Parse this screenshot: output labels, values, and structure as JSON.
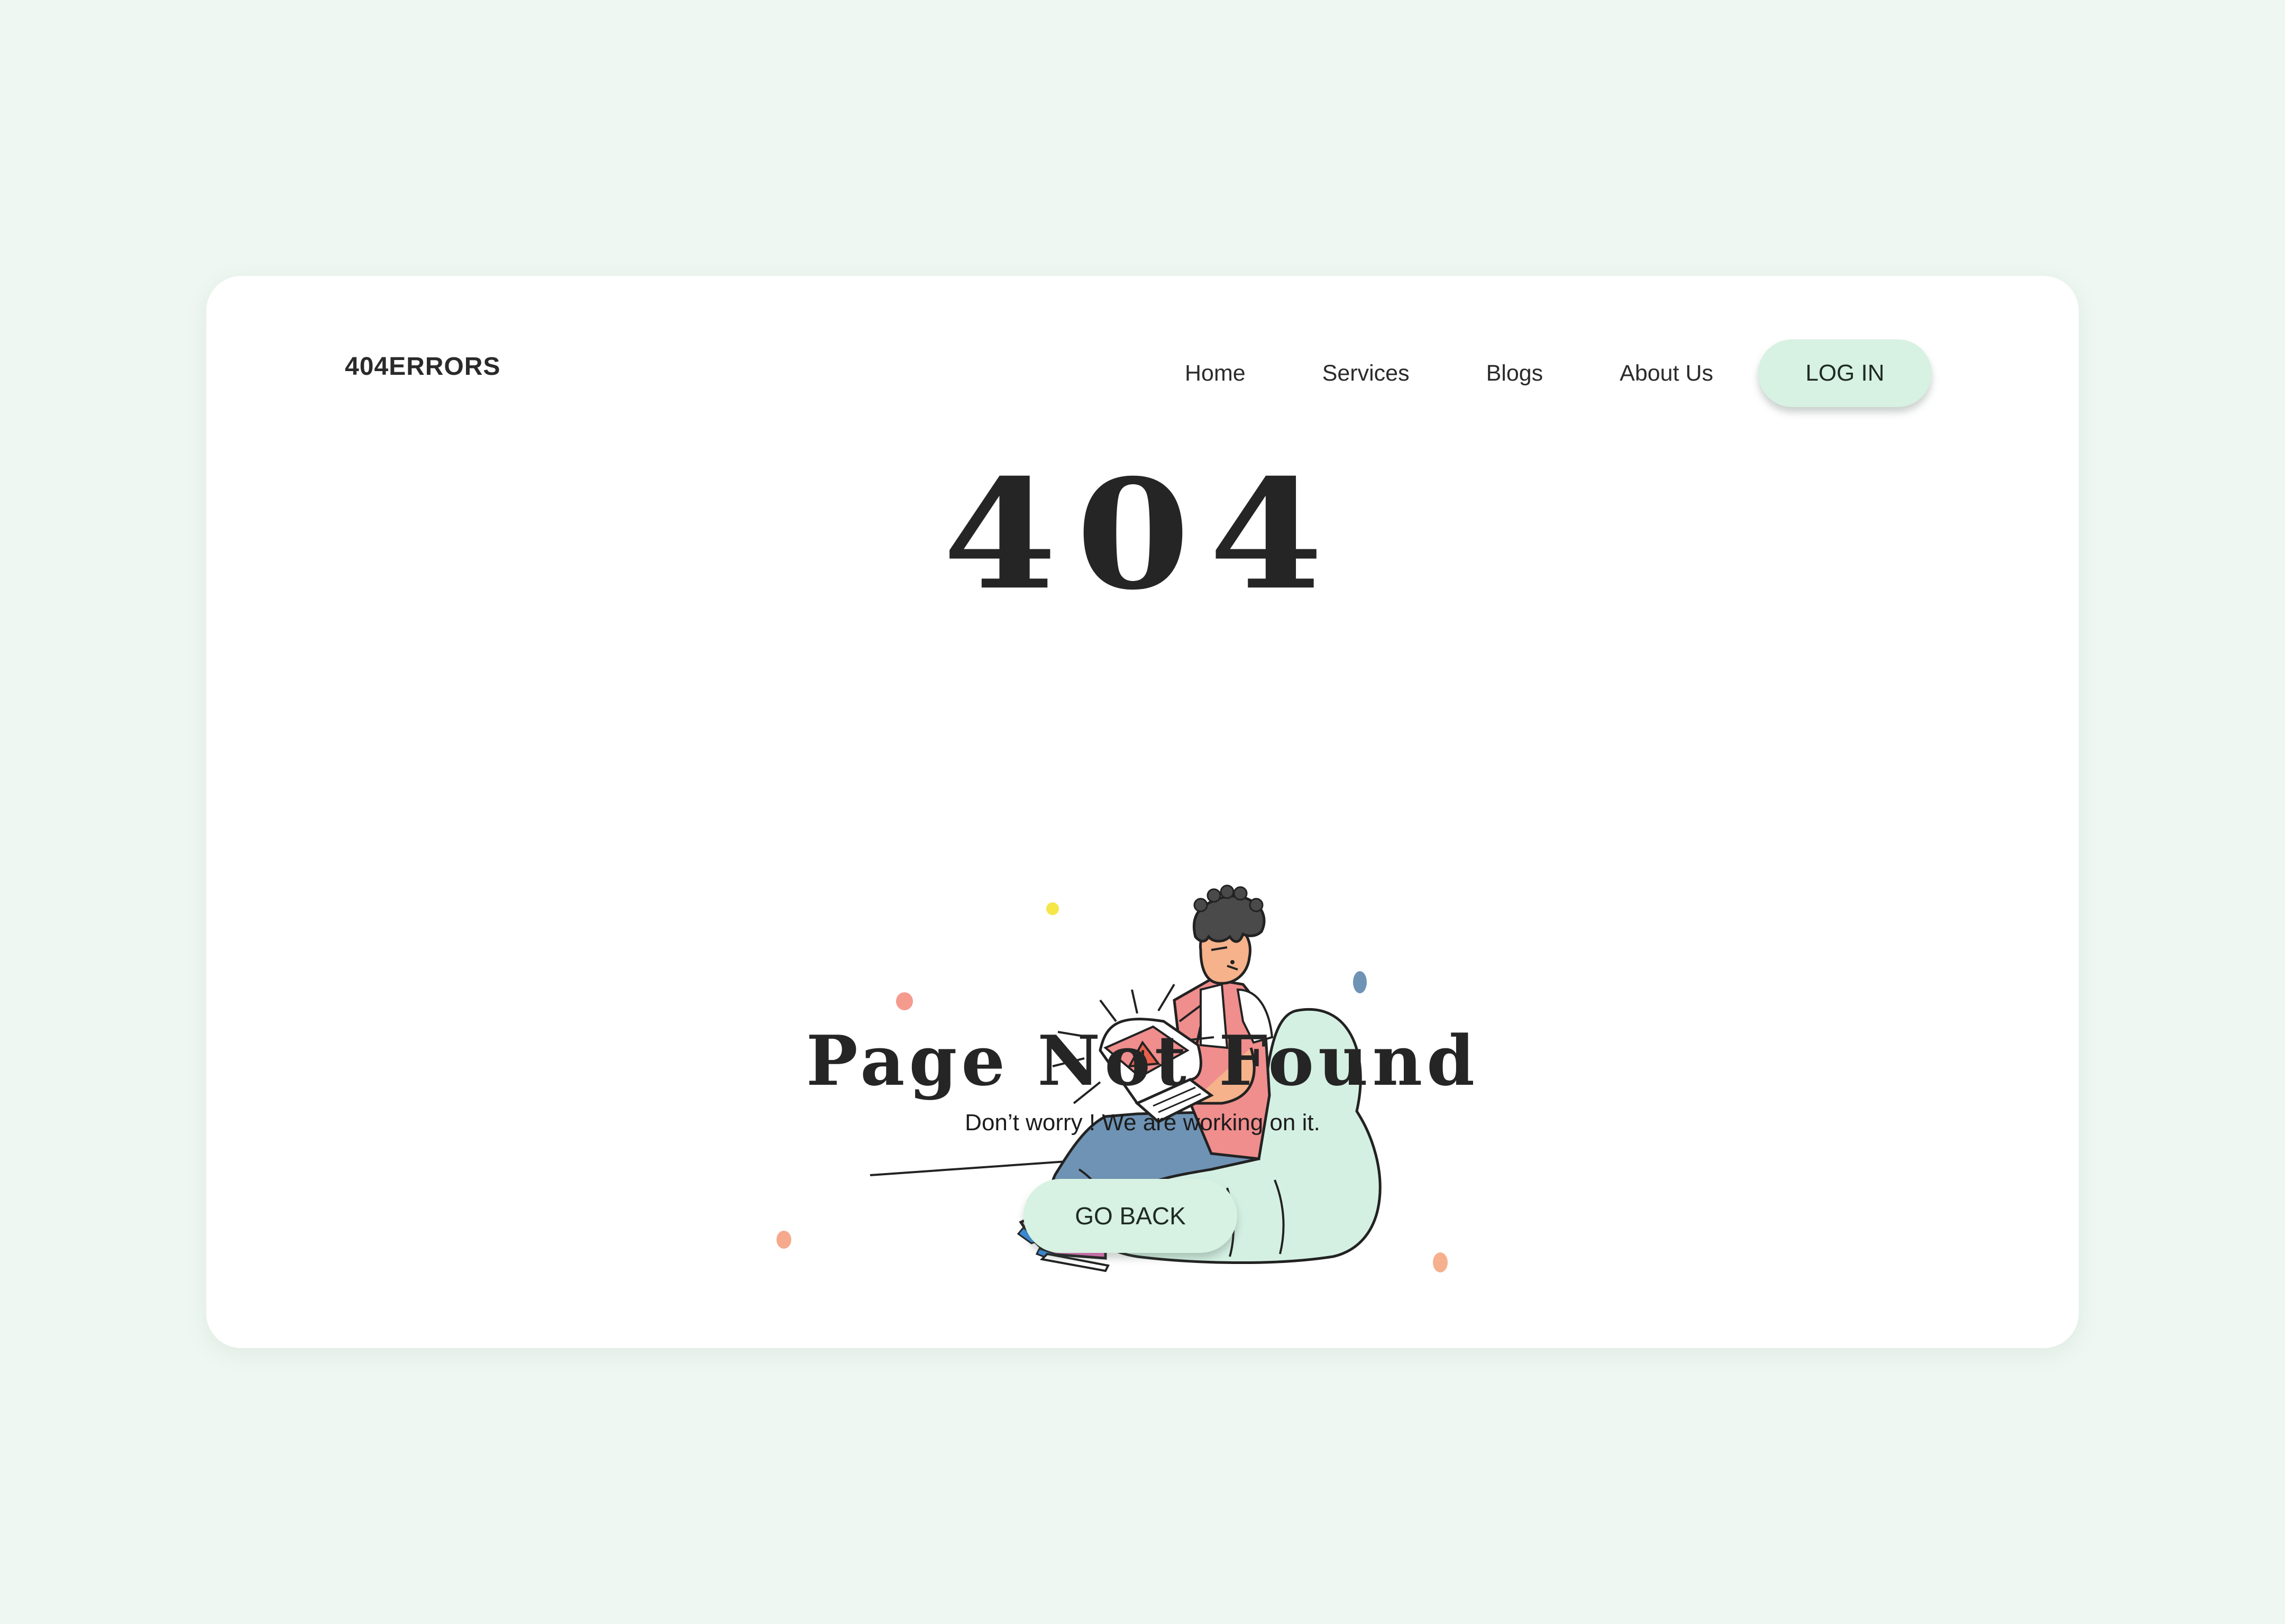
{
  "brand": {
    "name": "404ERRORS"
  },
  "nav": {
    "items": [
      {
        "label": "Home"
      },
      {
        "label": "Services"
      },
      {
        "label": "Blogs"
      },
      {
        "label": "About Us"
      }
    ],
    "login_label": "LOG IN"
  },
  "hero": {
    "code": "404",
    "title": "Page Not Found",
    "subtitle": "Don’t worry ! We are working on it.",
    "button_label": "GO BACK",
    "illustration_icon": "person-with-laptop-error-illustration"
  },
  "colors": {
    "page_background": "#eef7f1",
    "card_background": "#ffffff",
    "accent": "#d7f1e2",
    "text": "#252525",
    "warning": "#e8604c"
  }
}
